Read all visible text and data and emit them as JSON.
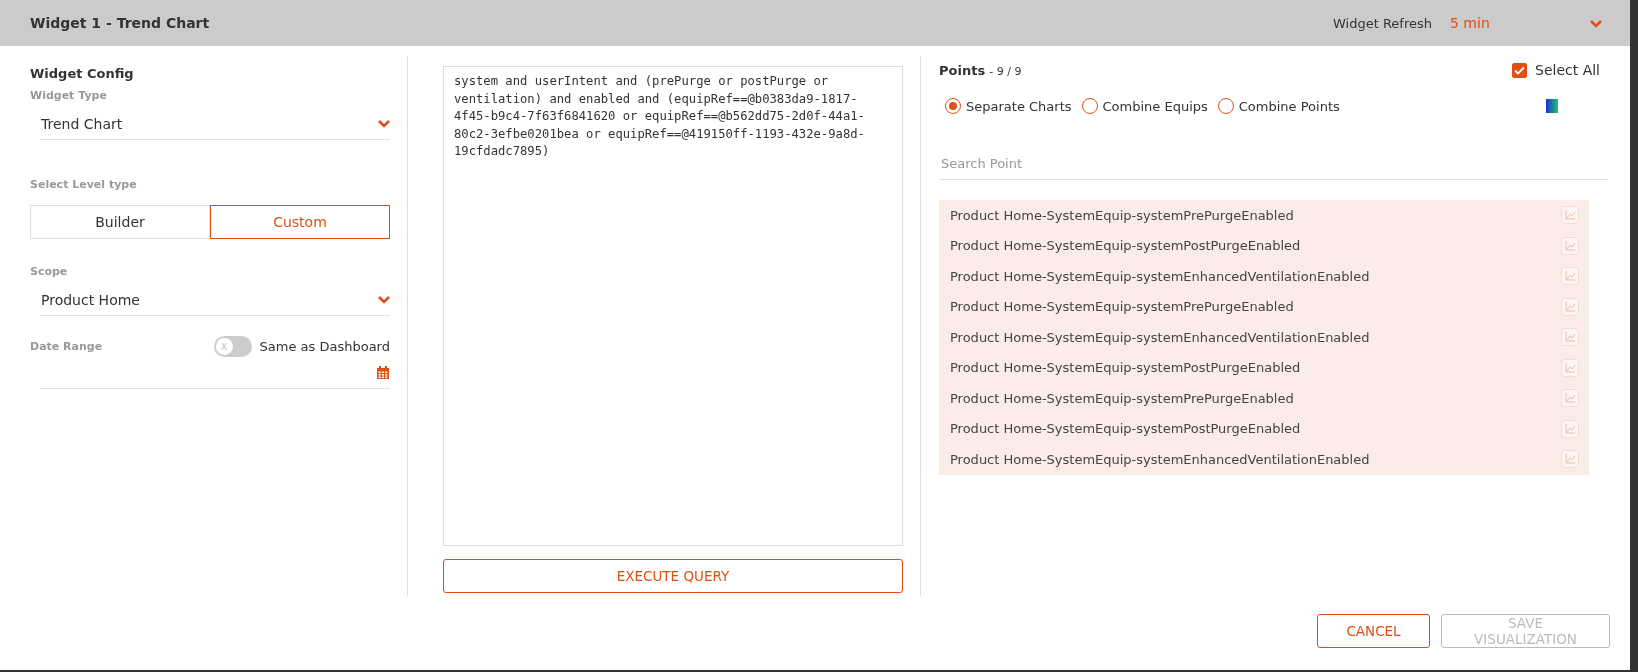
{
  "window": {
    "title": "Widget 1 - Trend Chart"
  },
  "refresh": {
    "label": "Widget Refresh",
    "value": "5 min"
  },
  "config": {
    "title": "Widget Config",
    "widget_type": {
      "label": "Widget Type",
      "value": "Trend Chart"
    },
    "level_type": {
      "label": "Select Level type",
      "options": [
        {
          "label": "Builder",
          "selected": false
        },
        {
          "label": "Custom",
          "selected": true
        }
      ]
    },
    "scope": {
      "label": "Scope",
      "value": "Product Home"
    },
    "date_range": {
      "label": "Date Range",
      "toggle_label": "Same as Dashboard",
      "toggle_on": false,
      "toggle_glyph": "X"
    }
  },
  "query": {
    "value": "system and userIntent and (prePurge or postPurge or ventilation) and enabled and (equipRef==@b0383da9-1817-4f45-b9c4-7f63f6841620 or equipRef==@b562dd75-2d0f-44a1-80c2-3efbe0201bea or equipRef==@419150ff-1193-432e-9a8d-19cfdadc7895)",
    "button": "EXECUTE QUERY"
  },
  "points": {
    "title": "Points",
    "count": "- 9 / 9",
    "select_all": {
      "label": "Select All",
      "checked": true
    },
    "modes": [
      {
        "label": "Separate Charts",
        "selected": true
      },
      {
        "label": "Combine Equips",
        "selected": false
      },
      {
        "label": "Combine Points",
        "selected": false
      }
    ],
    "search": {
      "placeholder": "Search Point"
    },
    "items": [
      {
        "label": "Product Home-SystemEquip-systemPrePurgeEnabled",
        "selected": true
      },
      {
        "label": "Product Home-SystemEquip-systemPostPurgeEnabled",
        "selected": true
      },
      {
        "label": "Product Home-SystemEquip-systemEnhancedVentilationEnabled",
        "selected": true
      },
      {
        "label": "Product Home-SystemEquip-systemPrePurgeEnabled",
        "selected": true
      },
      {
        "label": "Product Home-SystemEquip-systemEnhancedVentilationEnabled",
        "selected": true
      },
      {
        "label": "Product Home-SystemEquip-systemPostPurgeEnabled",
        "selected": true
      },
      {
        "label": "Product Home-SystemEquip-systemPrePurgeEnabled",
        "selected": true
      },
      {
        "label": "Product Home-SystemEquip-systemPostPurgeEnabled",
        "selected": true
      },
      {
        "label": "Product Home-SystemEquip-systemEnhancedVentilationEnabled",
        "selected": true
      }
    ]
  },
  "footer": {
    "buttons": [
      {
        "label": "CANCEL",
        "disabled": false
      },
      {
        "label": "SAVE VISUALIZATION",
        "disabled": true
      }
    ]
  }
}
